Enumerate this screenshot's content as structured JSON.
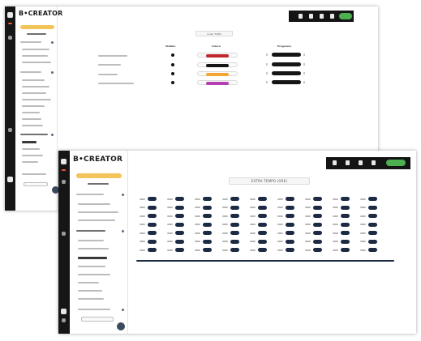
{
  "brand": {
    "logo_text": "B•CREATOR"
  },
  "colors": {
    "rail": "#161616",
    "accent_yellow": "#f3c45a",
    "green_button": "#4caf50",
    "navy_button": "#1c2a44"
  },
  "screen1": {
    "title": "Lista TABS",
    "columns": [
      "Visibile",
      "Colore",
      "Progresso"
    ],
    "rows": [
      {
        "swatch_color": "#c0272d"
      },
      {
        "swatch_color": "#151515"
      },
      {
        "swatch_color": "#f4a634"
      },
      {
        "swatch_color": "#b43fb0"
      }
    ]
  },
  "screen2": {
    "title": "EXTRA TEMPO (ORE)",
    "grid_rows": 7,
    "grid_cols": 9
  }
}
